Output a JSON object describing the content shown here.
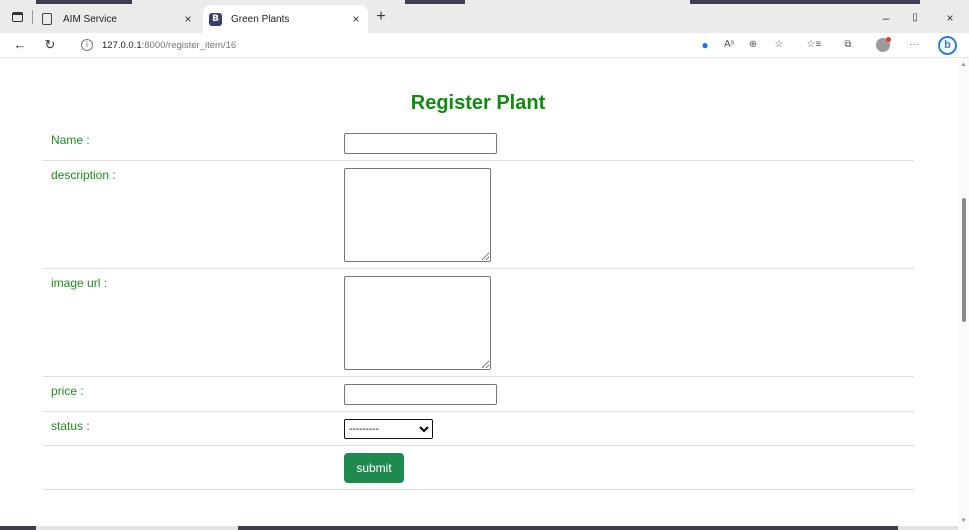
{
  "browser": {
    "tabs": [
      {
        "label": "AIM Service",
        "close": "×",
        "active": false
      },
      {
        "label": "Green Plants",
        "favicon": "B",
        "close": "×",
        "active": true
      }
    ],
    "new_tab": "+",
    "window_controls": {
      "minimize": "–",
      "restore": "▯",
      "close": "×"
    },
    "address": {
      "host": "127.0.0.1",
      "path": ":8000/register_item/16"
    },
    "toolbar_icons": [
      "tag-icon",
      "read-aloud-icon",
      "zoom-icon",
      "favorite-icon",
      "favorites-list-icon",
      "collections-icon",
      "profile-icon",
      "more-icon",
      "bing-icon"
    ],
    "toolbar_labels": {
      "read_aloud": "Aˢ",
      "zoom": "⊕",
      "favorite": "☆",
      "favorites": "☆≡",
      "collections": "⧉",
      "more": "···",
      "bing": "b"
    }
  },
  "page": {
    "title": "Register Plant",
    "form": {
      "name_label": "Name :",
      "name_value": "",
      "description_label": "description :",
      "description_value": "",
      "image_url_label": "image url :",
      "image_url_value": "",
      "price_label": "price :",
      "price_value": "",
      "status_label": "status :",
      "status_selected": "---------",
      "submit_label": "submit"
    }
  },
  "colors": {
    "label": "#228b22",
    "title": "#108a10",
    "button": "#1e8a50"
  }
}
